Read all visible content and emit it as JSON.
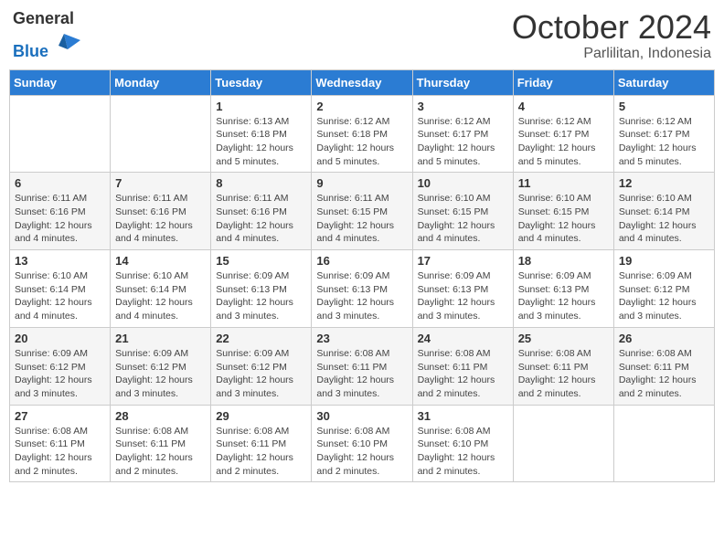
{
  "header": {
    "logo_general": "General",
    "logo_blue": "Blue",
    "month_title": "October 2024",
    "location": "Parlilitan, Indonesia"
  },
  "weekdays": [
    "Sunday",
    "Monday",
    "Tuesday",
    "Wednesday",
    "Thursday",
    "Friday",
    "Saturday"
  ],
  "weeks": [
    [
      null,
      null,
      {
        "day": "1",
        "sunrise": "Sunrise: 6:13 AM",
        "sunset": "Sunset: 6:18 PM",
        "daylight": "Daylight: 12 hours and 5 minutes."
      },
      {
        "day": "2",
        "sunrise": "Sunrise: 6:12 AM",
        "sunset": "Sunset: 6:18 PM",
        "daylight": "Daylight: 12 hours and 5 minutes."
      },
      {
        "day": "3",
        "sunrise": "Sunrise: 6:12 AM",
        "sunset": "Sunset: 6:17 PM",
        "daylight": "Daylight: 12 hours and 5 minutes."
      },
      {
        "day": "4",
        "sunrise": "Sunrise: 6:12 AM",
        "sunset": "Sunset: 6:17 PM",
        "daylight": "Daylight: 12 hours and 5 minutes."
      },
      {
        "day": "5",
        "sunrise": "Sunrise: 6:12 AM",
        "sunset": "Sunset: 6:17 PM",
        "daylight": "Daylight: 12 hours and 5 minutes."
      }
    ],
    [
      {
        "day": "6",
        "sunrise": "Sunrise: 6:11 AM",
        "sunset": "Sunset: 6:16 PM",
        "daylight": "Daylight: 12 hours and 4 minutes."
      },
      {
        "day": "7",
        "sunrise": "Sunrise: 6:11 AM",
        "sunset": "Sunset: 6:16 PM",
        "daylight": "Daylight: 12 hours and 4 minutes."
      },
      {
        "day": "8",
        "sunrise": "Sunrise: 6:11 AM",
        "sunset": "Sunset: 6:16 PM",
        "daylight": "Daylight: 12 hours and 4 minutes."
      },
      {
        "day": "9",
        "sunrise": "Sunrise: 6:11 AM",
        "sunset": "Sunset: 6:15 PM",
        "daylight": "Daylight: 12 hours and 4 minutes."
      },
      {
        "day": "10",
        "sunrise": "Sunrise: 6:10 AM",
        "sunset": "Sunset: 6:15 PM",
        "daylight": "Daylight: 12 hours and 4 minutes."
      },
      {
        "day": "11",
        "sunrise": "Sunrise: 6:10 AM",
        "sunset": "Sunset: 6:15 PM",
        "daylight": "Daylight: 12 hours and 4 minutes."
      },
      {
        "day": "12",
        "sunrise": "Sunrise: 6:10 AM",
        "sunset": "Sunset: 6:14 PM",
        "daylight": "Daylight: 12 hours and 4 minutes."
      }
    ],
    [
      {
        "day": "13",
        "sunrise": "Sunrise: 6:10 AM",
        "sunset": "Sunset: 6:14 PM",
        "daylight": "Daylight: 12 hours and 4 minutes."
      },
      {
        "day": "14",
        "sunrise": "Sunrise: 6:10 AM",
        "sunset": "Sunset: 6:14 PM",
        "daylight": "Daylight: 12 hours and 4 minutes."
      },
      {
        "day": "15",
        "sunrise": "Sunrise: 6:09 AM",
        "sunset": "Sunset: 6:13 PM",
        "daylight": "Daylight: 12 hours and 3 minutes."
      },
      {
        "day": "16",
        "sunrise": "Sunrise: 6:09 AM",
        "sunset": "Sunset: 6:13 PM",
        "daylight": "Daylight: 12 hours and 3 minutes."
      },
      {
        "day": "17",
        "sunrise": "Sunrise: 6:09 AM",
        "sunset": "Sunset: 6:13 PM",
        "daylight": "Daylight: 12 hours and 3 minutes."
      },
      {
        "day": "18",
        "sunrise": "Sunrise: 6:09 AM",
        "sunset": "Sunset: 6:13 PM",
        "daylight": "Daylight: 12 hours and 3 minutes."
      },
      {
        "day": "19",
        "sunrise": "Sunrise: 6:09 AM",
        "sunset": "Sunset: 6:12 PM",
        "daylight": "Daylight: 12 hours and 3 minutes."
      }
    ],
    [
      {
        "day": "20",
        "sunrise": "Sunrise: 6:09 AM",
        "sunset": "Sunset: 6:12 PM",
        "daylight": "Daylight: 12 hours and 3 minutes."
      },
      {
        "day": "21",
        "sunrise": "Sunrise: 6:09 AM",
        "sunset": "Sunset: 6:12 PM",
        "daylight": "Daylight: 12 hours and 3 minutes."
      },
      {
        "day": "22",
        "sunrise": "Sunrise: 6:09 AM",
        "sunset": "Sunset: 6:12 PM",
        "daylight": "Daylight: 12 hours and 3 minutes."
      },
      {
        "day": "23",
        "sunrise": "Sunrise: 6:08 AM",
        "sunset": "Sunset: 6:11 PM",
        "daylight": "Daylight: 12 hours and 3 minutes."
      },
      {
        "day": "24",
        "sunrise": "Sunrise: 6:08 AM",
        "sunset": "Sunset: 6:11 PM",
        "daylight": "Daylight: 12 hours and 2 minutes."
      },
      {
        "day": "25",
        "sunrise": "Sunrise: 6:08 AM",
        "sunset": "Sunset: 6:11 PM",
        "daylight": "Daylight: 12 hours and 2 minutes."
      },
      {
        "day": "26",
        "sunrise": "Sunrise: 6:08 AM",
        "sunset": "Sunset: 6:11 PM",
        "daylight": "Daylight: 12 hours and 2 minutes."
      }
    ],
    [
      {
        "day": "27",
        "sunrise": "Sunrise: 6:08 AM",
        "sunset": "Sunset: 6:11 PM",
        "daylight": "Daylight: 12 hours and 2 minutes."
      },
      {
        "day": "28",
        "sunrise": "Sunrise: 6:08 AM",
        "sunset": "Sunset: 6:11 PM",
        "daylight": "Daylight: 12 hours and 2 minutes."
      },
      {
        "day": "29",
        "sunrise": "Sunrise: 6:08 AM",
        "sunset": "Sunset: 6:11 PM",
        "daylight": "Daylight: 12 hours and 2 minutes."
      },
      {
        "day": "30",
        "sunrise": "Sunrise: 6:08 AM",
        "sunset": "Sunset: 6:10 PM",
        "daylight": "Daylight: 12 hours and 2 minutes."
      },
      {
        "day": "31",
        "sunrise": "Sunrise: 6:08 AM",
        "sunset": "Sunset: 6:10 PM",
        "daylight": "Daylight: 12 hours and 2 minutes."
      },
      null,
      null
    ]
  ]
}
